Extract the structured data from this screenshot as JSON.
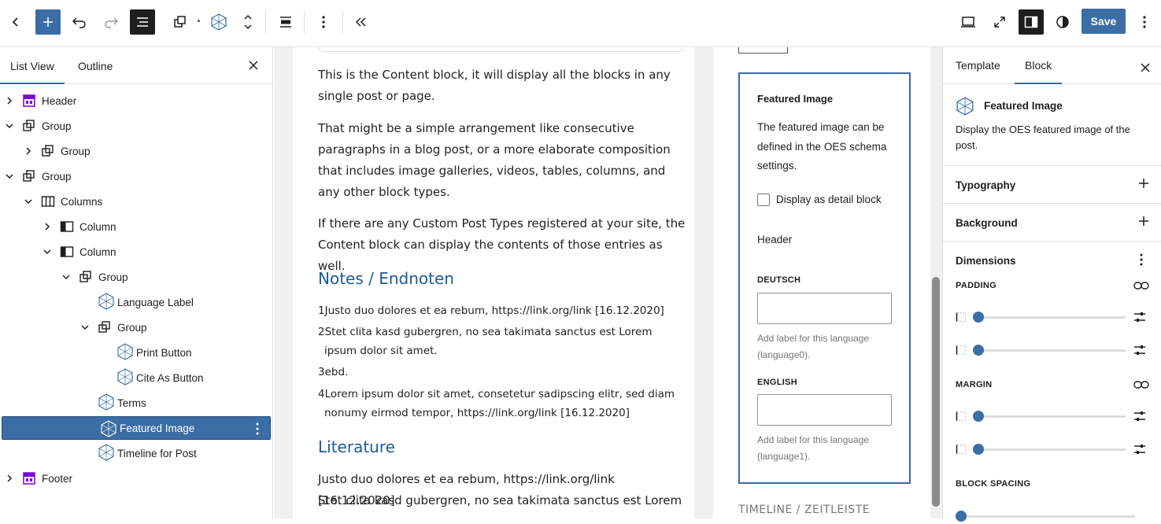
{
  "toolbar": {
    "save_label": "Save"
  },
  "left_panel": {
    "tabs": [
      "List View",
      "Outline"
    ],
    "tree": [
      {
        "label": "Header",
        "level": 0,
        "expand": "collapsed",
        "icon": "template-part-icon"
      },
      {
        "label": "Group",
        "level": 0,
        "expand": "expanded",
        "icon": "group-icon"
      },
      {
        "label": "Group",
        "level": 1,
        "expand": "collapsed",
        "icon": "group-icon"
      },
      {
        "label": "Group",
        "level": 0,
        "expand": "expanded",
        "icon": "group-icon"
      },
      {
        "label": "Columns",
        "level": 1,
        "expand": "expanded",
        "icon": "columns-icon"
      },
      {
        "label": "Column",
        "level": 2,
        "expand": "collapsed",
        "icon": "column-icon"
      },
      {
        "label": "Column",
        "level": 2,
        "expand": "expanded",
        "icon": "column-icon"
      },
      {
        "label": "Group",
        "level": 3,
        "expand": "expanded",
        "icon": "group-icon"
      },
      {
        "label": "Language Label",
        "level": 4,
        "expand": "none",
        "icon": "oes-icon"
      },
      {
        "label": "Group",
        "level": 4,
        "expand": "expanded",
        "icon": "group-icon"
      },
      {
        "label": "Print Button",
        "level": 5,
        "expand": "none",
        "icon": "oes-icon"
      },
      {
        "label": "Cite As Button",
        "level": 5,
        "expand": "none",
        "icon": "oes-icon"
      },
      {
        "label": "Terms",
        "level": 4,
        "expand": "none",
        "icon": "oes-icon"
      },
      {
        "label": "Featured Image",
        "level": 4,
        "expand": "none",
        "icon": "oes-icon",
        "selected": true
      },
      {
        "label": "Timeline for Post",
        "level": 4,
        "expand": "none",
        "icon": "oes-icon"
      },
      {
        "label": "Footer",
        "level": 0,
        "expand": "collapsed",
        "icon": "template-part-icon"
      }
    ]
  },
  "canvas": {
    "paragraphs": [
      "This is the Content block, it will display all the blocks in any single post or page.",
      "That might be a simple arrangement like consecutive paragraphs in a blog post, or a more elaborate composition that includes image galleries, videos, tables, columns, and any other block types.",
      "If there are any Custom Post Types registered at your site, the Content block can display the contents of those entries as well."
    ],
    "notes_heading": "Notes / Endnoten",
    "notes": [
      "1Justo duo dolores et ea rebum, https://link.org/link [16.12.2020]",
      "2Stet clita kasd gubergren, no sea takimata sanctus est Lorem ipsum dolor sit amet.",
      "3ebd.",
      "4Lorem ipsum dolor sit amet, consetetur sadipscing elitr, sed diam nonumy eirmod tempor, https://link.org/link [16.12.2020]"
    ],
    "literature_heading": "Literature",
    "literature": [
      "Justo duo dolores et ea rebum, https://link.org/link [16.12.2020]",
      "Stet clita kasd gubergren, no sea takimata sanctus est Lorem"
    ],
    "featured": {
      "title": "Featured Image",
      "description": "The featured image can be defined in the OES schema settings.",
      "checkbox_label": "Display as detail block",
      "header": "Header",
      "lang1": "DEUTSCH",
      "help1": "Add label for this language (language0).",
      "lang2": "ENGLISH",
      "help2": "Add label for this language (language1)."
    },
    "timeline_heading": "TIMELINE / ZEITLEISTE"
  },
  "right_panel": {
    "tabs": [
      "Template",
      "Block"
    ],
    "block_title": "Featured Image",
    "block_desc": "Display the OES featured image of the post.",
    "sections": [
      "Typography",
      "Background"
    ],
    "dimensions": "Dimensions",
    "padding": "PADDING",
    "margin": "MARGIN",
    "block_spacing": "BLOCK SPACING"
  },
  "colors": {
    "accent": "#3a6ea5",
    "heading": "#1d5a9a",
    "template_part": "#7a00df"
  }
}
